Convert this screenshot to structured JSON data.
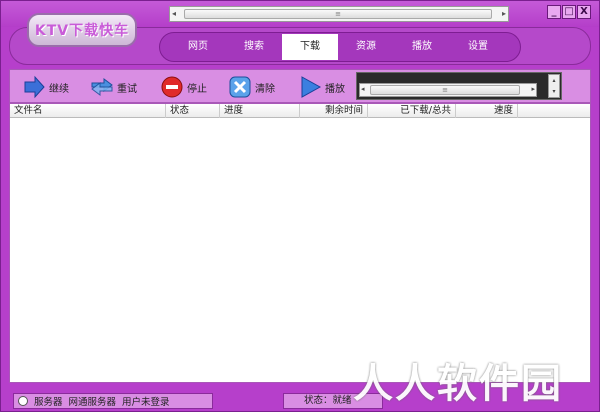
{
  "app": {
    "logo_text": "KTV下载快车"
  },
  "window_buttons": {
    "minimize": "_",
    "maximize": "□",
    "close": "X"
  },
  "nav": {
    "tabs": [
      {
        "label": "网页",
        "active": false
      },
      {
        "label": "搜索",
        "active": false
      },
      {
        "label": "下载",
        "active": true
      },
      {
        "label": "资源",
        "active": false
      },
      {
        "label": "播放",
        "active": false
      },
      {
        "label": "设置",
        "active": false
      }
    ]
  },
  "toolbar": {
    "continue_label": "继续",
    "retry_label": "重试",
    "stop_label": "停止",
    "clear_label": "清除",
    "play_label": "播放"
  },
  "list": {
    "columns": [
      "文件名",
      "状态",
      "进度",
      "剩余时间",
      "已下载/总共",
      "速度"
    ],
    "rows": []
  },
  "statusbar": {
    "server_label": "服务器",
    "server_value": "网通服务器",
    "login_status": "用户未登录",
    "status_text": "状态：就绪"
  },
  "watermark": "人人软件园",
  "colors": {
    "accent": "#b63fcb",
    "toolbar": "#d98ee3"
  }
}
